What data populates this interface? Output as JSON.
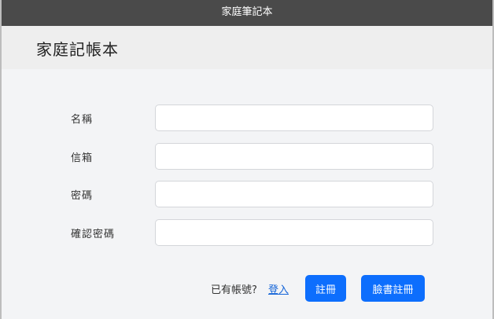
{
  "window": {
    "title": "家庭筆記本"
  },
  "header": {
    "title": "家庭記帳本"
  },
  "form": {
    "fields": [
      {
        "label": "名稱",
        "value": "",
        "placeholder": ""
      },
      {
        "label": "信箱",
        "value": "",
        "placeholder": ""
      },
      {
        "label": "密碼",
        "value": "",
        "placeholder": ""
      },
      {
        "label": "確認密碼",
        "value": "",
        "placeholder": ""
      }
    ]
  },
  "actions": {
    "has_account_prompt": "已有帳號?",
    "login_link": "登入",
    "register_button": "註冊",
    "facebook_register_button": "臉書註冊"
  },
  "colors": {
    "titlebar": "#4a4a4a",
    "header_bg": "#eeeeee",
    "page_bg": "#f3f4f6",
    "primary": "#0d6efd",
    "link": "#1565d8"
  }
}
